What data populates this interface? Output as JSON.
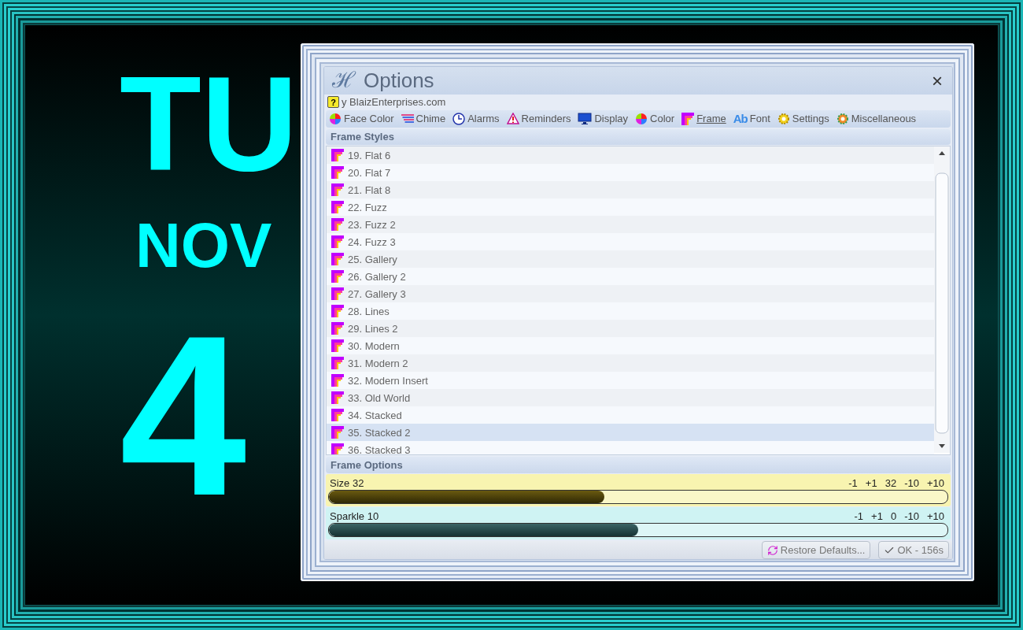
{
  "clock": {
    "lines": [
      {
        "kind": "day",
        "text": "TU"
      },
      {
        "kind": "month",
        "text": "NOV"
      },
      {
        "kind": "date",
        "text": "4"
      }
    ]
  },
  "window": {
    "logo": "ℋ",
    "title": "Options",
    "close": "×",
    "help_badge": "?",
    "link": "y BlaizEnterprises.com"
  },
  "tabs": [
    {
      "label": "Face Color",
      "selected": false
    },
    {
      "label": "Chime",
      "selected": false
    },
    {
      "label": "Alarms",
      "selected": false
    },
    {
      "label": "Reminders",
      "selected": false
    },
    {
      "label": "Display",
      "selected": false
    },
    {
      "label": "Color",
      "selected": false
    },
    {
      "label": "Frame",
      "selected": true
    },
    {
      "label": "Font",
      "selected": false,
      "badge": "Ab"
    },
    {
      "label": "Settings",
      "selected": false
    },
    {
      "label": "Miscellaneous",
      "selected": false
    }
  ],
  "frame_styles": {
    "header": "Frame Styles",
    "items": [
      {
        "label": "19. Flat 6",
        "selected": false
      },
      {
        "label": "20. Flat 7",
        "selected": false
      },
      {
        "label": "21. Flat 8",
        "selected": false
      },
      {
        "label": "22. Fuzz",
        "selected": false
      },
      {
        "label": "23. Fuzz 2",
        "selected": false
      },
      {
        "label": "24. Fuzz 3",
        "selected": false
      },
      {
        "label": "25. Gallery",
        "selected": false
      },
      {
        "label": "26. Gallery 2",
        "selected": false
      },
      {
        "label": "27. Gallery 3",
        "selected": false
      },
      {
        "label": "28. Lines",
        "selected": false
      },
      {
        "label": "29. Lines 2",
        "selected": false
      },
      {
        "label": "30. Modern",
        "selected": false
      },
      {
        "label": "31. Modern 2",
        "selected": false
      },
      {
        "label": "32. Modern Insert",
        "selected": false
      },
      {
        "label": "33. Old World",
        "selected": false
      },
      {
        "label": "34. Stacked",
        "selected": false
      },
      {
        "label": "35. Stacked 2",
        "selected": true
      },
      {
        "label": "36. Stacked 3",
        "selected": false
      }
    ]
  },
  "frame_options": {
    "header": "Frame Options",
    "sliders": [
      {
        "label": "Size 32",
        "color": "#f8f4b0",
        "level": 0.445,
        "steps": [
          "-1",
          "+1",
          "32",
          "-10",
          "+10"
        ]
      },
      {
        "label": "Sparkle 10",
        "color": "#cff3f3",
        "level": 0.5,
        "steps": [
          "-1",
          "+1",
          "0",
          "-10",
          "+10"
        ]
      }
    ]
  },
  "buttons": [
    {
      "kind": "restore",
      "label": "Restore Defaults..."
    },
    {
      "kind": "ok",
      "label": "OK - 156s"
    }
  ]
}
